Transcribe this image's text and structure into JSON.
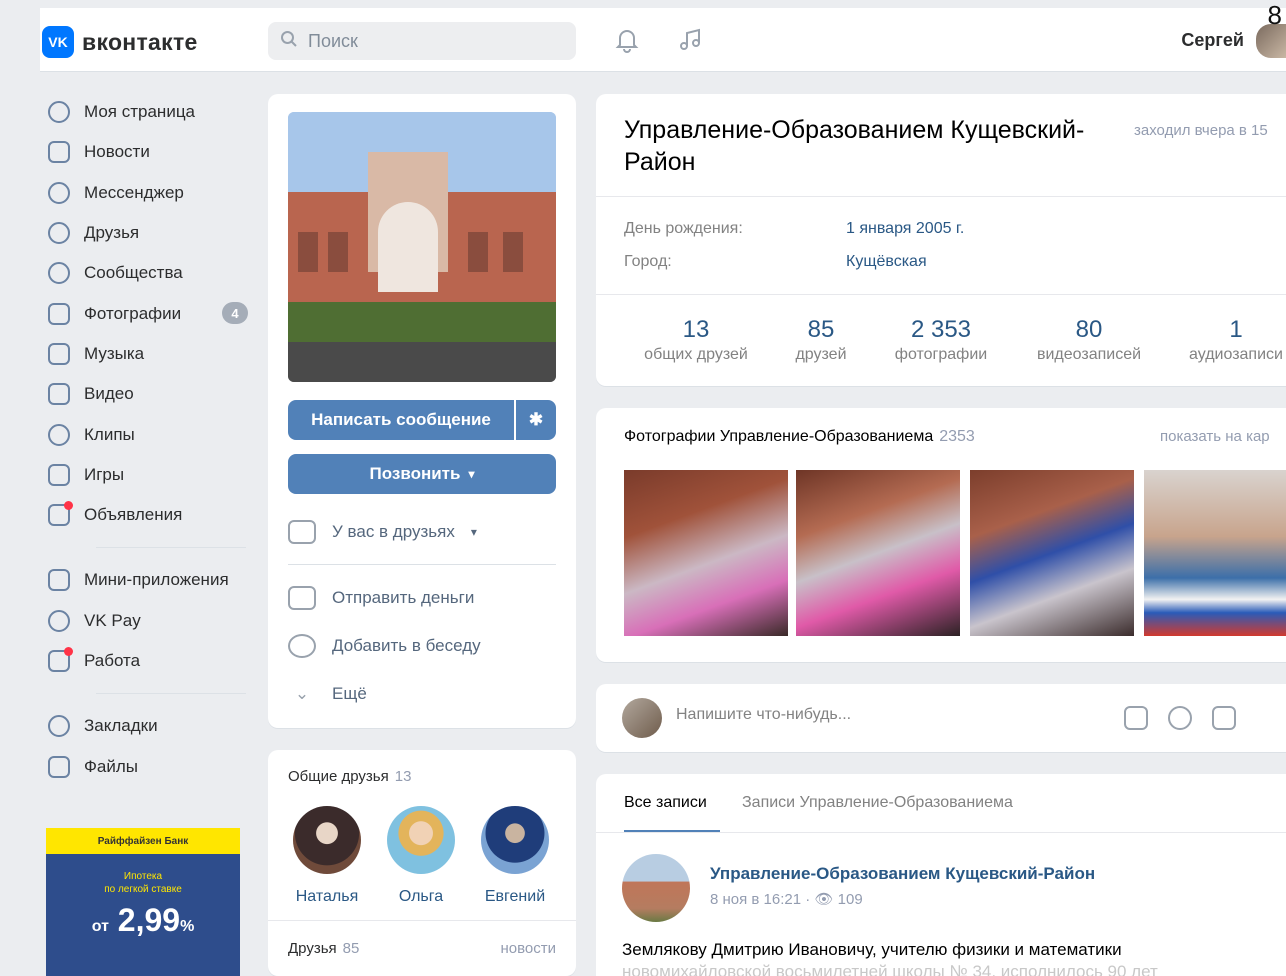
{
  "header": {
    "logo_text": "вконтакте",
    "logo_mark": "VK",
    "search_placeholder": "Поиск",
    "user_name": "Сергей",
    "corner_number": "8",
    "icons": [
      "bell-icon",
      "music-icon"
    ]
  },
  "sidebar": {
    "items": [
      {
        "label": "Моя страница",
        "icon": "user-icon"
      },
      {
        "label": "Новости",
        "icon": "news-icon"
      },
      {
        "label": "Мессенджер",
        "icon": "message-icon"
      },
      {
        "label": "Друзья",
        "icon": "friends-icon"
      },
      {
        "label": "Сообщества",
        "icon": "community-icon"
      },
      {
        "label": "Фотографии",
        "icon": "photo-icon",
        "badge": "4"
      },
      {
        "label": "Музыка",
        "icon": "music-icon"
      },
      {
        "label": "Видео",
        "icon": "video-icon"
      },
      {
        "label": "Клипы",
        "icon": "clips-icon"
      },
      {
        "label": "Игры",
        "icon": "games-icon"
      },
      {
        "label": "Объявления",
        "icon": "ads-icon"
      },
      {
        "label": "Мини-приложения",
        "icon": "apps-icon"
      },
      {
        "label": "VK Pay",
        "icon": "vkpay-icon"
      },
      {
        "label": "Работа",
        "icon": "work-icon"
      },
      {
        "label": "Закладки",
        "icon": "star-icon"
      },
      {
        "label": "Файлы",
        "icon": "file-icon"
      }
    ]
  },
  "ad": {
    "bank": "Райффайзен Банк",
    "line1": "Ипотека",
    "line2": "по легкой ставке",
    "prefix": "от",
    "rate": "2,99",
    "unit": "%"
  },
  "profile": {
    "write_message": "Написать сообщение",
    "call": "Позвонить",
    "in_friends": "У вас в друзьях",
    "send_money": "Отправить деньги",
    "add_to_chat": "Добавить в беседу",
    "more": "Ещё"
  },
  "common_friends": {
    "title": "Общие друзья",
    "count": "13",
    "people": [
      "Наталья",
      "Ольга",
      "Евгений"
    ],
    "friends_title": "Друзья",
    "friends_count": "85",
    "news_link": "новости"
  },
  "info": {
    "name": "Управление-Образованием Кущевский-Район",
    "last_seen": "заходил вчера в 15",
    "birthday_label": "День рождения:",
    "birthday_value": "1 января 2005 г.",
    "city_label": "Город:",
    "city_value": "Кущёвская",
    "counters": [
      {
        "n": "13",
        "t": "общих друзей"
      },
      {
        "n": "85",
        "t": "друзей"
      },
      {
        "n": "2 353",
        "t": "фотографии"
      },
      {
        "n": "80",
        "t": "видеозаписей"
      },
      {
        "n": "1",
        "t": "аудиозаписи"
      }
    ]
  },
  "photos": {
    "title": "Фотографии Управление-Образованиема",
    "count": "2353",
    "more": "показать на кар"
  },
  "compose": {
    "placeholder": "Напишите что-нибудь..."
  },
  "wall": {
    "tab_all": "Все записи",
    "tab_own": "Записи Управление-Образованиема",
    "post_author": "Управление-Образованием Кущевский-Район",
    "post_date": "8 ноя в 16:21",
    "post_views": "109",
    "post_text": "Землякову Дмитрию Ивановичу, учителю физики и математики",
    "post_text2": "новомихайловской восьмилетней школы № 34, исполнилось 90 лет"
  },
  "colors": {
    "accent": "#5181b8",
    "link": "#2a5885",
    "background": "#ebedf0",
    "vk_blue": "#0077ff"
  }
}
